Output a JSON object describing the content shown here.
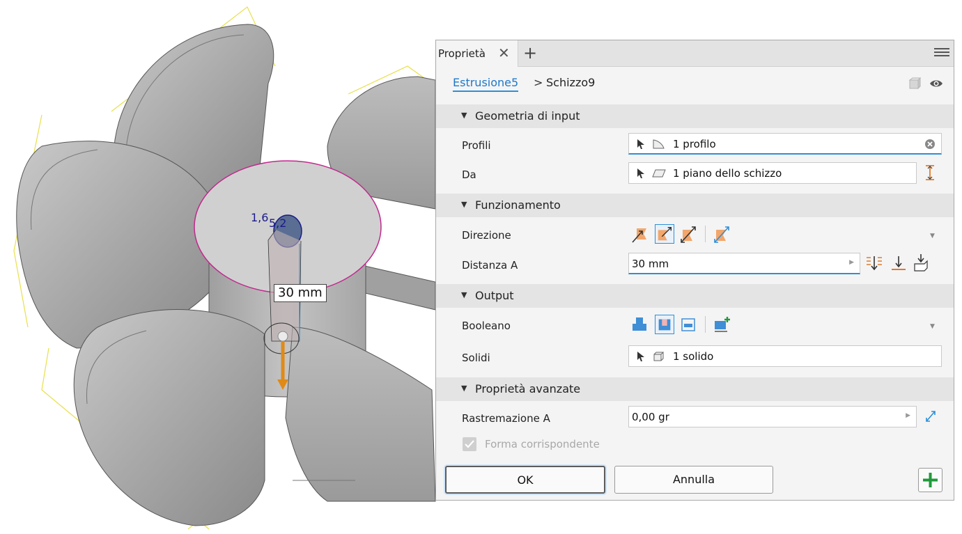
{
  "viewport": {
    "dimension_value": "30 mm",
    "dim_label_a": "1,6",
    "dim_label_b": "5,2"
  },
  "panel": {
    "tab_label": "Proprietà",
    "breadcrumb": {
      "parent": "Estrusione5",
      "separator": ">",
      "current": "Schizzo9"
    },
    "sections": {
      "input_geometry": {
        "title": "Geometria di input",
        "profiles_label": "Profili",
        "profiles_value": "1 profilo",
        "from_label": "Da",
        "from_value": "1 piano dello schizzo"
      },
      "behavior": {
        "title": "Funzionamento",
        "direction_label": "Direzione",
        "distance_label": "Distanza A",
        "distance_value": "30 mm"
      },
      "output": {
        "title": "Output",
        "boolean_label": "Booleano",
        "solids_label": "Solidi",
        "solids_value": "1 solido"
      },
      "advanced": {
        "title": "Proprietà avanzate",
        "taper_label": "Rastremazione A",
        "taper_value": "0,00 gr",
        "match_shape_label": "Forma corrispondente",
        "match_shape_checked": true
      }
    },
    "buttons": {
      "ok": "OK",
      "cancel": "Annulla"
    },
    "colors": {
      "accent": "#2d8fd8",
      "add_green": "#1e9a3a",
      "direction_orange": "#f2a66b",
      "boolean_blue": "#3f8ed6"
    }
  }
}
